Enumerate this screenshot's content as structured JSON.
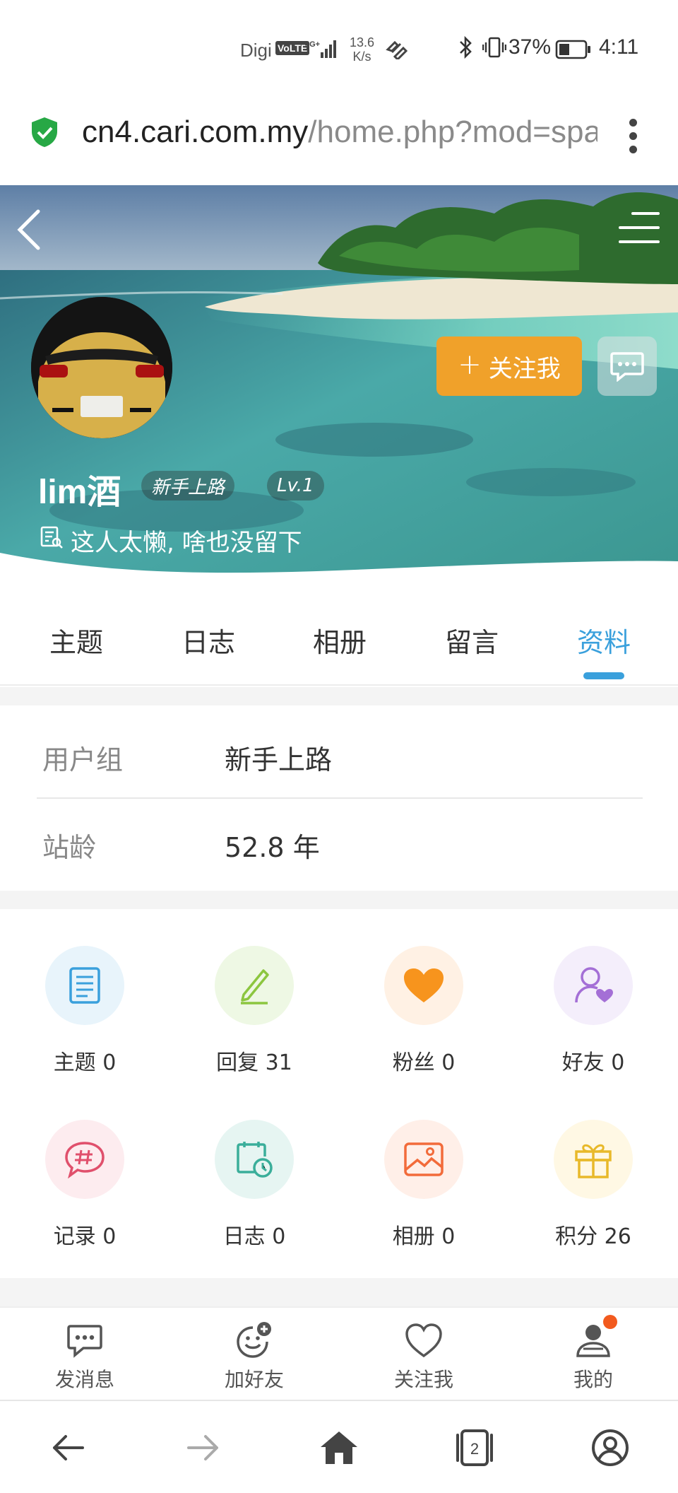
{
  "status_bar": {
    "carrier": "Digi",
    "volte": "VoLTE",
    "network": "4G+",
    "speed_value": "13.6",
    "speed_unit": "K/s",
    "battery_percent": "37%",
    "time": "4:11"
  },
  "url_bar": {
    "domain": "cn4.cari.com.my",
    "path": "/home.php?mod=spa"
  },
  "profile": {
    "username": "lim酒",
    "group_badge": "新手上路",
    "level_badge": "Lv.1",
    "signature": "这人太懒, 啥也没留下",
    "follow_button": "关注我"
  },
  "tabs": [
    {
      "label": "主题",
      "active": false
    },
    {
      "label": "日志",
      "active": false
    },
    {
      "label": "相册",
      "active": false
    },
    {
      "label": "留言",
      "active": false
    },
    {
      "label": "资料",
      "active": true
    }
  ],
  "info": {
    "rows": [
      {
        "label": "用户组",
        "value": "新手上路"
      },
      {
        "label": "站龄",
        "value": "52.8 年"
      }
    ]
  },
  "stats": [
    {
      "label": "主题 0",
      "icon": "document-icon",
      "bg": "#e8f4fb",
      "color": "#3aa0dc"
    },
    {
      "label": "回复 31",
      "icon": "pencil-icon",
      "bg": "#eef8e4",
      "color": "#8cc63f"
    },
    {
      "label": "粉丝 0",
      "icon": "heart-icon",
      "bg": "#fff1e4",
      "color": "#f7941d"
    },
    {
      "label": "好友 0",
      "icon": "friend-icon",
      "bg": "#f4eefb",
      "color": "#a46fd6"
    },
    {
      "label": "记录 0",
      "icon": "hashtag-bubble-icon",
      "bg": "#fdecef",
      "color": "#e0506c"
    },
    {
      "label": "日志 0",
      "icon": "calendar-clock-icon",
      "bg": "#e6f5f2",
      "color": "#3aae9a"
    },
    {
      "label": "相册 0",
      "icon": "photo-icon",
      "bg": "#ffefe8",
      "color": "#f26b3a"
    },
    {
      "label": "积分 26",
      "icon": "gift-icon",
      "bg": "#fff8e4",
      "color": "#e8b92a"
    }
  ],
  "actions": [
    {
      "label": "发消息",
      "icon": "message-icon"
    },
    {
      "label": "加好友",
      "icon": "add-friend-icon"
    },
    {
      "label": "关注我",
      "icon": "heart-outline-icon"
    },
    {
      "label": "我的",
      "icon": "user-icon"
    }
  ],
  "browser_nav": {
    "tab_count": "2"
  }
}
